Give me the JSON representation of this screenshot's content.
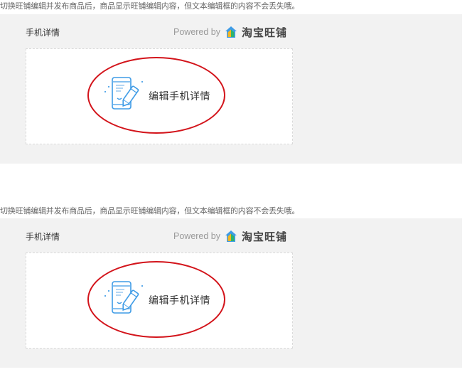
{
  "sections": [
    {
      "notice": "切换旺铺编辑并发布商品后，商品显示旺铺编辑内容，但文本编辑框的内容不会丢失哦。",
      "title": "手机详情",
      "powered_by": "Powered by",
      "brand": "淘宝旺铺",
      "edit_label": "编辑手机详情"
    },
    {
      "notice": "切换旺铺编辑并发布商品后，商品显示旺铺编辑内容，但文本编辑框的内容不会丢失哦。",
      "title": "手机详情",
      "powered_by": "Powered by",
      "brand": "淘宝旺铺",
      "edit_label": "编辑手机详情"
    }
  ],
  "colors": {
    "panel_bg": "#f2f2f2",
    "accent_blue": "#3e9be6",
    "annotation_red": "#d3141b"
  },
  "icons": {
    "brand": "taobao-wangpu-house-icon",
    "edit": "phone-edit-icon"
  }
}
